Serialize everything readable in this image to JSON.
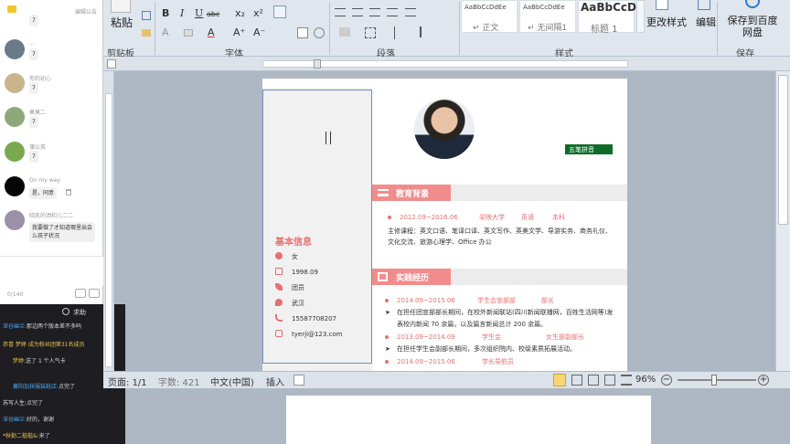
{
  "chat": {
    "top_link": "编辑公告",
    "messages": [
      {
        "badge": "7"
      },
      {
        "name": "...",
        "badge": "7"
      },
      {
        "name": "你的初心",
        "badge": "7"
      },
      {
        "name": "莫莫二",
        "badge": "7"
      },
      {
        "name": "蒲公英",
        "badge": "7"
      },
      {
        "name": "On my way",
        "text": "是，同意"
      },
      {
        "name": "晓凯的洒和儿二二",
        "text": "我要做了才知道哪里出会么孩子状况"
      }
    ],
    "counter": "0/140",
    "help": "求助"
  },
  "live": [
    {
      "user": "深谷幽兰:",
      "text": "那边两个版本差不多吗",
      "color": "#4fa3e8"
    },
    {
      "user": "恭喜 梦婷 成为粉丝团第31名成员",
      "text": "",
      "color": "#e8c04f"
    },
    {
      "user": "梦婷:",
      "text": "送了 1 个人气卡",
      "color": "#e8c04f"
    },
    {
      "user": "襄阳加抹服装鞋店:",
      "text": "点完了",
      "color": "#4fa3e8"
    },
    {
      "user": "苏写人生:",
      "text": "点完了",
      "color": "#e8e8e8"
    },
    {
      "user": "深谷幽兰:",
      "text": "好的，谢谢",
      "color": "#4fa3e8"
    },
    {
      "user": "*秋勒二楷楷&:",
      "text": "来了",
      "color": "#e8c04f"
    }
  ],
  "ribbon": {
    "paste": "粘贴",
    "groups": [
      "剪贴板",
      "字体",
      "段落",
      "样式",
      "保存"
    ],
    "font_buttons": [
      "B",
      "I",
      "U",
      "abc",
      "x₂",
      "x²",
      "A",
      "A",
      "A⁺",
      "A⁻"
    ],
    "styles": [
      {
        "preview": "AaBbCcDdEe",
        "name": "↵ 正文"
      },
      {
        "preview": "AaBbCcDdEe",
        "name": "↵ 无间隔1"
      },
      {
        "preview": "AaBbCcD",
        "name": "标题 1"
      }
    ],
    "change_styles": "更改样式",
    "edit": "编辑",
    "save_cloud": "保存到百度网盘"
  },
  "resume": {
    "badge": "五笔拼音",
    "section_basic": "基本信息",
    "basic": [
      "女",
      "1998.09",
      "团员",
      "武汉",
      "15587708207",
      "tyerji@123.com"
    ],
    "section_edu": "教育背景",
    "edu_line": [
      "2012.09~2016.06",
      "梁映大学",
      "英语",
      "本科"
    ],
    "edu_desc": [
      "主修课程：英文口语、笔译口译、英文写作、英美文学、导游实务、商务礼仪、",
      "文化交流、旅游心理学、Office 办公"
    ],
    "section_exp": "实践经历",
    "exp": [
      {
        "date": "2014.09~2015.06",
        "org": "学生会宣部部",
        "role": "部长",
        "desc": [
          "在担任团宣部部长期间，在校外新闻联站(四川新闻联播网，百姓生活网等)发",
          "表校内新闻 70 余篇，以及篇言新闻总计 200 余篇。"
        ]
      },
      {
        "date": "2013.09~2014.09",
        "org": "学生会",
        "role": "女生部副部长",
        "desc": [
          "在担任学生会副部长期间，多次组织院内、校级素质拓展活动。"
        ]
      },
      {
        "date": "2014.09~2015.06",
        "org": "学长导航员",
        "role": "",
        "desc": []
      }
    ]
  },
  "status": {
    "page": "页面: 1/1",
    "words": "字数: 421",
    "lang": "中文(中国)",
    "mode": "插入",
    "zoom": "96%"
  }
}
